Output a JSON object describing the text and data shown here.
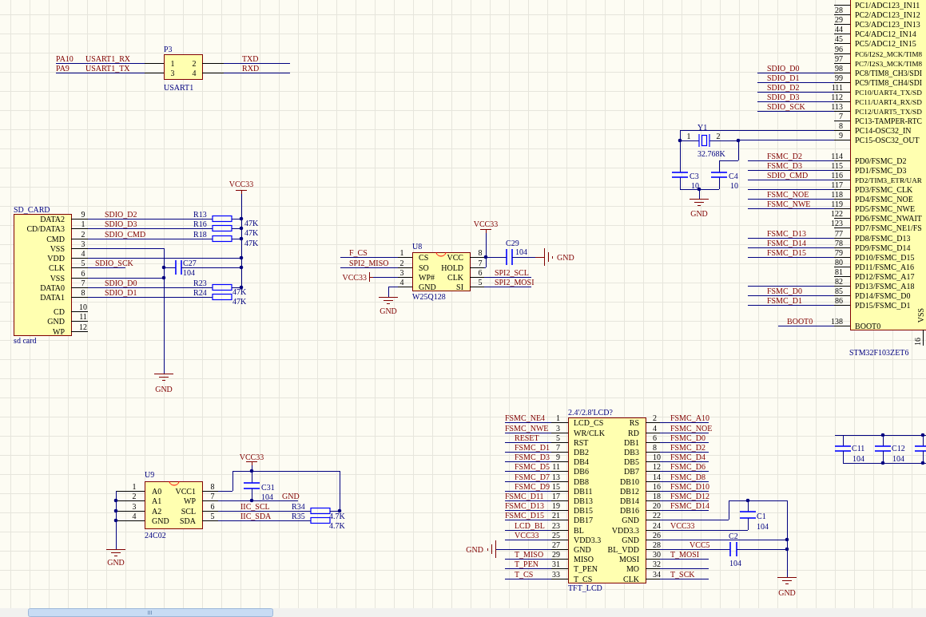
{
  "usart_header": {
    "designator": "P3",
    "comment": "USART1",
    "pin_numbers": [
      "1",
      "2",
      "3",
      "4"
    ],
    "left_nets": [
      {
        "port": "PA10",
        "net": "USART1_RX"
      },
      {
        "port": "PA9",
        "net": "USART1_TX"
      }
    ],
    "right_nets": [
      "TXD",
      "RXD"
    ]
  },
  "sd_card": {
    "designator": "SD_CARD",
    "comment": "sd card",
    "pins": [
      {
        "name": "DATA2",
        "number": "9",
        "net": "SDIO_D2"
      },
      {
        "name": "CD/DATA3",
        "number": "1",
        "net": "SDIO_D3"
      },
      {
        "name": "CMD",
        "number": "2",
        "net": "SDIO_CMD"
      },
      {
        "name": "VSS",
        "number": "3"
      },
      {
        "name": "VDD",
        "number": "4"
      },
      {
        "name": "CLK",
        "number": "5",
        "net": "SDIO_SCK"
      },
      {
        "name": "VSS",
        "number": "6"
      },
      {
        "name": "DATA0",
        "number": "7",
        "net": "SDIO_D0"
      },
      {
        "name": "DATA1",
        "number": "8",
        "net": "SDIO_D1"
      },
      {
        "name": "CD",
        "number": "10"
      },
      {
        "name": "GND",
        "number": "11"
      },
      {
        "name": "WP",
        "number": "12"
      }
    ],
    "pullups": [
      {
        "designator": "R13",
        "value": "47K"
      },
      {
        "designator": "R16",
        "value": "47K"
      },
      {
        "designator": "R18",
        "value": "47K"
      },
      {
        "designator": "R23",
        "value": "47K"
      },
      {
        "designator": "R24",
        "value": "47K"
      }
    ],
    "capacitor": {
      "designator": "C27",
      "value": "104"
    },
    "power": "VCC33",
    "ground": "GND"
  },
  "flash": {
    "designator": "U8",
    "comment": "W25Q128",
    "left_pins": [
      {
        "name": "CS",
        "number": "1",
        "net": "F_CS"
      },
      {
        "name": "SO",
        "number": "2",
        "net": "SPI2_MISO"
      },
      {
        "name": "WP#",
        "number": "3",
        "power": "VCC33"
      },
      {
        "name": "GND",
        "number": "4",
        "ground": "GND"
      }
    ],
    "right_pins": [
      {
        "name": "VCC",
        "number": "8"
      },
      {
        "name": "HOLD",
        "number": "7"
      },
      {
        "name": "CLK",
        "number": "6",
        "net": "SPI2_SCL"
      },
      {
        "name": "SI",
        "number": "5",
        "net": "SPI2_MOSI"
      }
    ],
    "power": "VCC33",
    "capacitor": {
      "designator": "C29",
      "value": "104"
    },
    "capacitor_ground": "GND"
  },
  "mcu": {
    "designator": "STM32F103ZET6",
    "pins": [
      {
        "name": "PC1/ADC123_IN11"
      },
      {
        "name": "PC2/ADC123_IN12",
        "number": "28"
      },
      {
        "name": "PC3/ADC123_IN13",
        "number": "29"
      },
      {
        "name": "PC4/ADC12_IN14",
        "number": "44"
      },
      {
        "name": "PC5/ADC12_IN15",
        "number": "45"
      },
      {
        "name": "PC6/I2S2_MCK/TIM8",
        "number": "96"
      },
      {
        "name": "PC7/I2S3_MCK/TIM8",
        "number": "97"
      },
      {
        "name": "PC8/TIM8_CH3/SDI",
        "number": "98",
        "net": "SDIO_D0"
      },
      {
        "name": "PC9/TIM8_CH4/SDI",
        "number": "99",
        "net": "SDIO_D1"
      },
      {
        "name": "PC10/UART4_TX/SD",
        "number": "111",
        "net": "SDIO_D2"
      },
      {
        "name": "PC11/UART4_RX/SD",
        "number": "112",
        "net": "SDIO_D3"
      },
      {
        "name": "PC12/UART5_TX/SD",
        "number": "113",
        "net": "SDIO_SCK"
      },
      {
        "name": "PC13-TAMPER-RTC",
        "number": "7"
      },
      {
        "name": "PC14-OSC32_IN",
        "number": "8"
      },
      {
        "name": "PC15-OSC32_OUT",
        "number": "9"
      },
      {
        "name": "PD0/FSMC_D2",
        "number": "114",
        "net": "FSMC_D2"
      },
      {
        "name": "PD1/FSMC_D3",
        "number": "115",
        "net": "FSMC_D3"
      },
      {
        "name": "PD2/TIM3_ETR/UAR",
        "number": "116",
        "net": "SDIO_CMD"
      },
      {
        "name": "PD3/FSMC_CLK",
        "number": "117"
      },
      {
        "name": "PD4/FSMC_NOE",
        "number": "118",
        "net": "FSMC_NOE"
      },
      {
        "name": "PD5/FSMC_NWE",
        "number": "119",
        "net": "FSMC_NWE"
      },
      {
        "name": "PD6/FSMC_NWAIT",
        "number": "122"
      },
      {
        "name": "PD7/FSMC_NE1/FS",
        "number": "123"
      },
      {
        "name": "PD8/FSMC_D13",
        "number": "77",
        "net": "FSMC_D13"
      },
      {
        "name": "PD9/FSMC_D14",
        "number": "78",
        "net": "FSMC_D14"
      },
      {
        "name": "PD10/FSMC_D15",
        "number": "79",
        "net": "FSMC_D15"
      },
      {
        "name": "PD11/FSMC_A16",
        "number": "80"
      },
      {
        "name": "PD12/FSMC_A17",
        "number": "81"
      },
      {
        "name": "PD13/FSMC_A18",
        "number": "82"
      },
      {
        "name": "PD14/FSMC_D0",
        "number": "85",
        "net": "FSMC_D0"
      },
      {
        "name": "PD15/FSMC_D1",
        "number": "86",
        "net": "FSMC_D1"
      },
      {
        "name": "BOOT0",
        "number": "138",
        "net": "BOOT0"
      }
    ],
    "bottom_pin": {
      "name": "VSS",
      "number": "16"
    },
    "crystal": {
      "designator": "Y1",
      "value": "32.768K",
      "pin_numbers": [
        "1",
        "2"
      ]
    },
    "load_capacitors": [
      {
        "designator": "C3",
        "value": "10"
      },
      {
        "designator": "C4",
        "value": "10"
      }
    ],
    "ground": "GND"
  },
  "eeprom": {
    "designator": "U9",
    "comment": "24C02",
    "left_pins": [
      {
        "name": "A0",
        "number": "1"
      },
      {
        "name": "A1",
        "number": "2"
      },
      {
        "name": "A2",
        "number": "3"
      },
      {
        "name": "GND",
        "number": "4"
      }
    ],
    "right_pins": [
      {
        "name": "VCC1",
        "number": "8"
      },
      {
        "name": "WP",
        "number": "7",
        "net": "GND"
      },
      {
        "name": "SCL",
        "number": "6",
        "net": "IIC_SCL"
      },
      {
        "name": "SDA",
        "number": "5",
        "net": "IIC_SDA"
      }
    ],
    "pullups": [
      {
        "designator": "R34",
        "value": "4.7K"
      },
      {
        "designator": "R35",
        "value": "4.7K"
      }
    ],
    "capacitor": {
      "designator": "C31",
      "value": "104"
    },
    "power": "VCC33",
    "ground": "GND"
  },
  "lcd": {
    "designator": "2.4'/2.8'LCD?",
    "comment": "TFT_LCD",
    "left_pins": [
      {
        "name": "LCD_CS",
        "number": "1",
        "net": "FSMC_NE4"
      },
      {
        "name": "WR/CLK",
        "number": "3",
        "net": "FSMC_NWE"
      },
      {
        "name": "RST",
        "number": "5",
        "net": "RESET"
      },
      {
        "name": "DB2",
        "number": "7",
        "net": "FSMC_D1"
      },
      {
        "name": "DB4",
        "number": "9",
        "net": "FSMC_D3"
      },
      {
        "name": "DB6",
        "number": "11",
        "net": "FSMC_D5"
      },
      {
        "name": "DB8",
        "number": "13",
        "net": "FSMC_D7"
      },
      {
        "name": "DB11",
        "number": "15",
        "net": "FSMC_D9"
      },
      {
        "name": "DB13",
        "number": "17",
        "net": "FSMC_D11"
      },
      {
        "name": "DB15",
        "number": "19",
        "net": "FSMC_D13"
      },
      {
        "name": "DB17",
        "number": "21",
        "net": "FSMC_D15"
      },
      {
        "name": "BL",
        "number": "23",
        "net": "LCD_BL"
      },
      {
        "name": "VDD3.3",
        "number": "25",
        "net": "VCC33"
      },
      {
        "name": "GND",
        "number": "27",
        "ground": "GND"
      },
      {
        "name": "MISO",
        "number": "29",
        "net": "T_MISO"
      },
      {
        "name": "T_PEN",
        "number": "31",
        "net": "T_PEN"
      },
      {
        "name": "T_CS",
        "number": "33",
        "net": "T_CS"
      }
    ],
    "right_pins": [
      {
        "name": "RS",
        "number": "2",
        "net": "FSMC_A10"
      },
      {
        "name": "RD",
        "number": "4",
        "net": "FSMC_NOE"
      },
      {
        "name": "DB1",
        "number": "6",
        "net": "FSMC_D0"
      },
      {
        "name": "DB3",
        "number": "8",
        "net": "FSMC_D2"
      },
      {
        "name": "DB5",
        "number": "10",
        "net": "FSMC_D4"
      },
      {
        "name": "DB7",
        "number": "12",
        "net": "FSMC_D6"
      },
      {
        "name": "DB10",
        "number": "14",
        "net": "FSMC_D8"
      },
      {
        "name": "DB12",
        "number": "16",
        "net": "FSMC_D10"
      },
      {
        "name": "DB14",
        "number": "18",
        "net": "FSMC_D12"
      },
      {
        "name": "DB16",
        "number": "20",
        "net": "FSMC_D14"
      },
      {
        "name": "GND",
        "number": "22"
      },
      {
        "name": "VDD3.3",
        "number": "24",
        "net": "VCC33"
      },
      {
        "name": "GND",
        "number": "26"
      },
      {
        "name": "BL_VDD",
        "number": "28",
        "net": "VCC5"
      },
      {
        "name": "MOSI",
        "number": "30",
        "net": "T_MOSI"
      },
      {
        "name": "MO",
        "number": "32"
      },
      {
        "name": "CLK",
        "number": "34",
        "net": "T_SCK"
      }
    ],
    "capacitors": [
      {
        "designator": "C1",
        "value": "104"
      },
      {
        "designator": "C2",
        "value": "104"
      }
    ],
    "ground": "GND"
  },
  "decoupling": [
    {
      "designator": "C11",
      "value": "104"
    },
    {
      "designator": "C12",
      "value": "104"
    }
  ]
}
